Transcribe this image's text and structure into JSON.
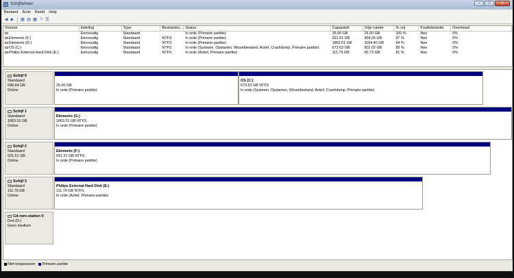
{
  "window": {
    "title": "Schijfbeheer",
    "controls": [
      "–",
      "□",
      "✕"
    ]
  },
  "menu": [
    "Bestand",
    "Actie",
    "Beeld",
    "Help"
  ],
  "table": {
    "columns": [
      "Volume",
      "Indeling",
      "Type",
      "Bestandss...",
      "Status",
      "Capaciteit",
      "Vrije ruimte",
      "% vrij",
      "Fouttolerantie",
      "Overhead"
    ],
    "rows": [
      [
        "",
        "Eenvoudig",
        "Standaard",
        "",
        "In orde (Primaire partitie)",
        "25.00 GB",
        "25.00 GB",
        "100 %",
        "Nee",
        "0%"
      ],
      [
        "Elements (F:)",
        "Eenvoudig",
        "Standaard",
        "NTFS",
        "In orde (Primaire partitie)",
        "931.51 GB",
        "904.26 GB",
        "97 %",
        "Nee",
        "0%"
      ],
      [
        "Elements (G:)",
        "Eenvoudig",
        "Standaard",
        "NTFS",
        "In orde (Primaire partitie)",
        "1863.01 GB",
        "1194.40 GB",
        "64 %",
        "Nee",
        "0%"
      ],
      [
        "OS (C:)",
        "Eenvoudig",
        "Standaard",
        "NTFS",
        "In orde (Systeem, Opstarten, Wisselbestand, Actief, Crashdump, Primaire partitie)",
        "673.63 GB",
        "602.02 GB",
        "89 %",
        "Nee",
        "0%"
      ],
      [
        "Philips External Hard Disk (E:)",
        "Eenvoudig",
        "Standaard",
        "NTFS",
        "In orde (Actief, Primaire partitie)",
        "111.79 GB",
        "90.73 GB",
        "81 %",
        "Nee",
        "0%"
      ]
    ]
  },
  "disks": [
    {
      "name": "Schijf 0",
      "type": "Standaard",
      "size": "698.64 GB",
      "state": "Online",
      "partitions": [
        {
          "title": "",
          "size": "25.00 GB",
          "status": "In orde (Primaire partitie)"
        },
        {
          "title": "OS  (C:)",
          "size": "673.63 GB NTFS",
          "status": "In orde (Systeem, Opstarten, Wisselbestand, Actief, Crashdump, Primaire partitie)"
        }
      ]
    },
    {
      "name": "Schijf 1",
      "type": "Standaard",
      "size": "1863.01 GB",
      "state": "Online",
      "partitions": [
        {
          "title": "Elements  (G:)",
          "size": "1863.01 GB NTFS",
          "status": "In orde (Primaire partitie)"
        }
      ]
    },
    {
      "name": "Schijf 2",
      "type": "Standaard",
      "size": "931.51 GB",
      "state": "Online",
      "partitions": [
        {
          "title": "Elements  (F:)",
          "size": "931.51 GB NTFS",
          "status": "In orde (Primaire partitie)"
        }
      ]
    },
    {
      "name": "Schijf 3",
      "type": "Standaard",
      "size": "111.79 GB",
      "state": "Online",
      "partitions": [
        {
          "title": "Philips External Hard Disk  (E:)",
          "size": "111.79 GB NTFS",
          "status": "In orde (Actief, Primaire partitie)"
        }
      ]
    },
    {
      "name": "Cd-rom-station 0",
      "type": "Dvd (D:)",
      "size": "",
      "state": "Geen medium",
      "partitions": []
    }
  ],
  "legend": [
    {
      "label": "Niet-toegewezen",
      "color": "#000000"
    },
    {
      "label": "Primaire partitie",
      "color": "#00007f"
    }
  ]
}
